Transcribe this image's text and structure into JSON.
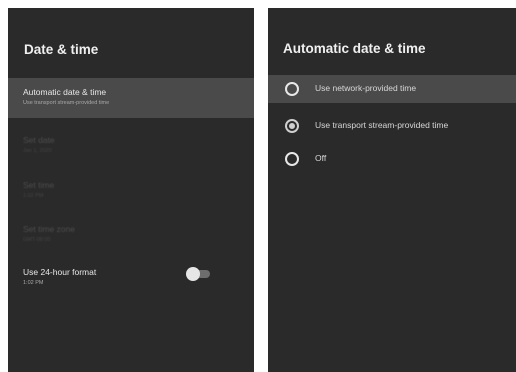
{
  "left_panel": {
    "title": "Date & time",
    "items": [
      {
        "title": "Automatic date & time",
        "subtitle": "Use transport stream-provided time"
      },
      {
        "title": "Set date",
        "subtitle": "Jan 1, 2020"
      },
      {
        "title": "Set time",
        "subtitle": "1:02 PM"
      },
      {
        "title": "Set time zone",
        "subtitle": "GMT-08:00"
      },
      {
        "title": "Use 24-hour format",
        "subtitle": "1:02 PM"
      }
    ],
    "toggle_24h": {
      "state": "off"
    }
  },
  "right_panel": {
    "title": "Automatic date & time",
    "options": [
      {
        "label": "Use network-provided time",
        "selected": false
      },
      {
        "label": "Use transport stream-provided time",
        "selected": true
      },
      {
        "label": "Off",
        "selected": false
      }
    ]
  }
}
